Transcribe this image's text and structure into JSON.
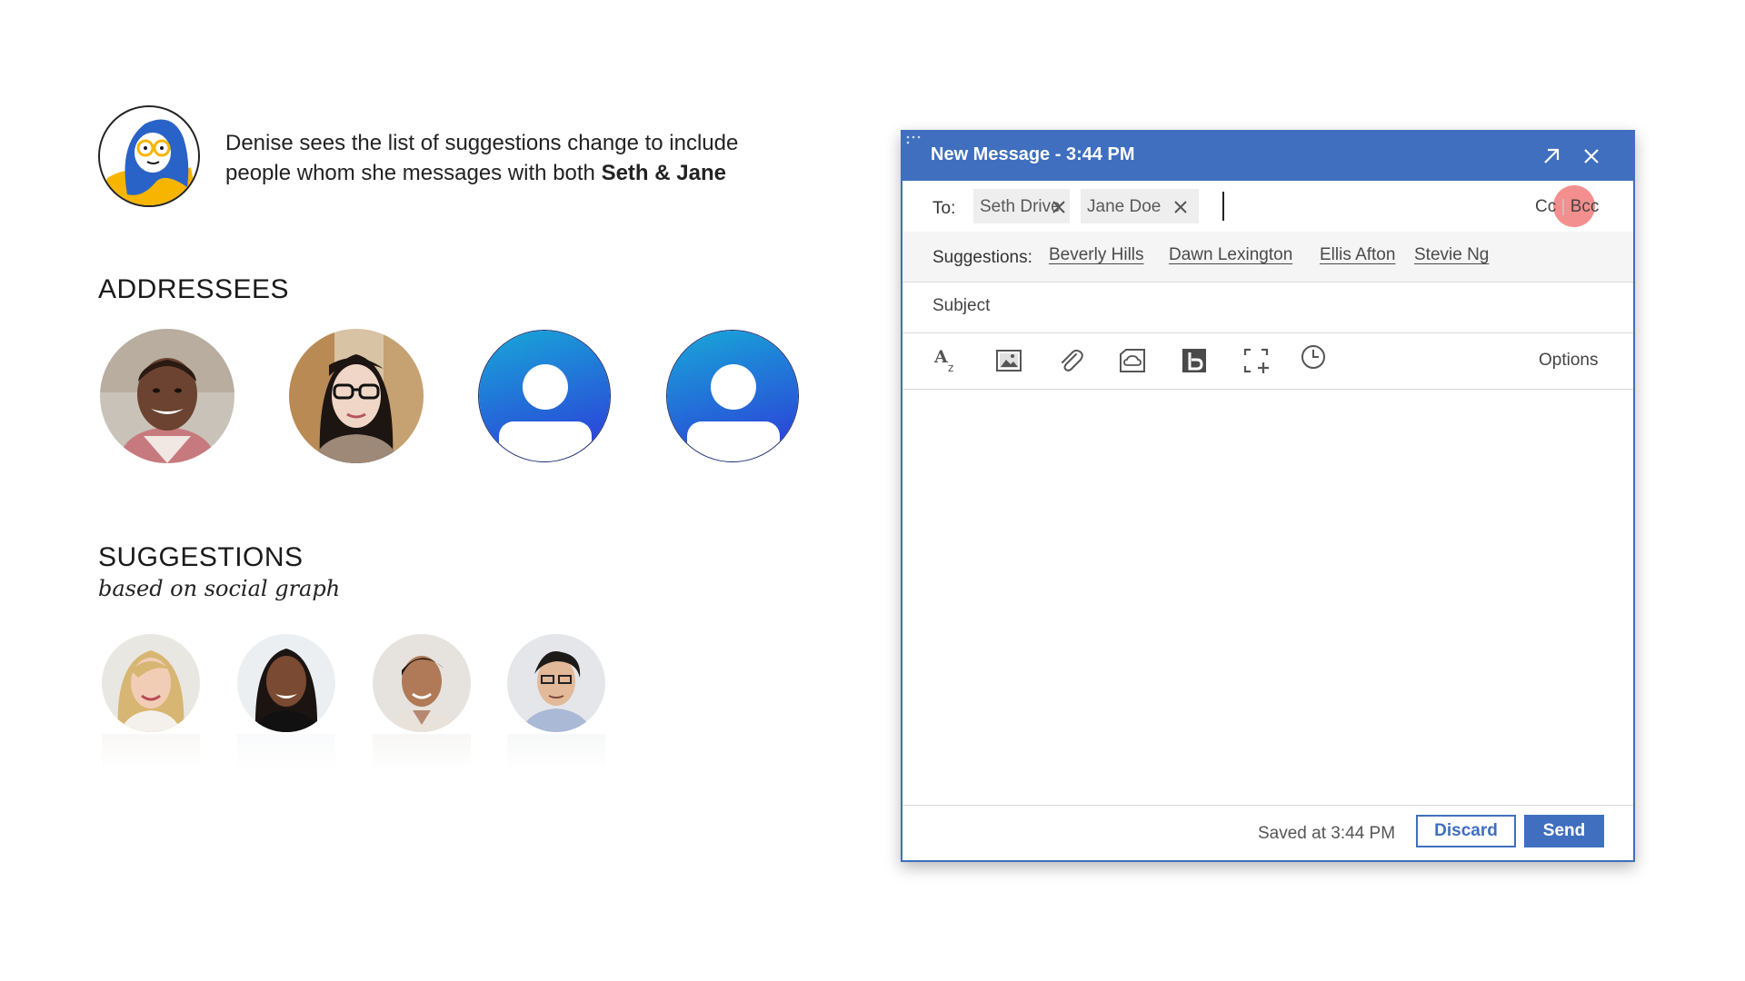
{
  "narration": {
    "text_lead": "Denise sees the list of suggestions change to include people whom she messages with both ",
    "text_bold": "Seth & Jane"
  },
  "addressees": {
    "heading": "ADDRESSEES",
    "avatars": [
      {
        "kind": "photo",
        "icon": "person-photo"
      },
      {
        "kind": "photo",
        "icon": "person-photo"
      },
      {
        "kind": "generic",
        "icon": "user-placeholder-icon"
      },
      {
        "kind": "generic",
        "icon": "user-placeholder-icon"
      }
    ]
  },
  "suggestions_panel": {
    "heading": "SUGGESTIONS",
    "subheading": "based on social graph"
  },
  "compose": {
    "title": "New Message - 3:44 PM",
    "to_label": "To:",
    "recipients": [
      "Seth Drive",
      "Jane Doe"
    ],
    "cc_label": "Cc",
    "separator": "|",
    "bcc_label": "Bcc",
    "suggestions_label": "Suggestions:",
    "suggestions": [
      "Beverly Hills",
      "Dawn Lexington",
      "Ellis Afton",
      "Stevie Ng"
    ],
    "subject_placeholder": "Subject",
    "toolbar_icons": [
      "font-size-icon",
      "insert-image-icon",
      "attach-icon",
      "cloud-file-icon",
      "bold-b-icon",
      "screenshot-icon",
      "schedule-clock-icon"
    ],
    "options_label": "Options",
    "saved_text": "Saved at 3:44 PM",
    "discard_label": "Discard",
    "send_label": "Send"
  },
  "colors": {
    "brand_blue": "#3f6fbe",
    "avatar_gradient_top": "#19a0d8",
    "avatar_gradient_bottom": "#2c3fd8",
    "touch_indicator": "#ec4a48"
  }
}
